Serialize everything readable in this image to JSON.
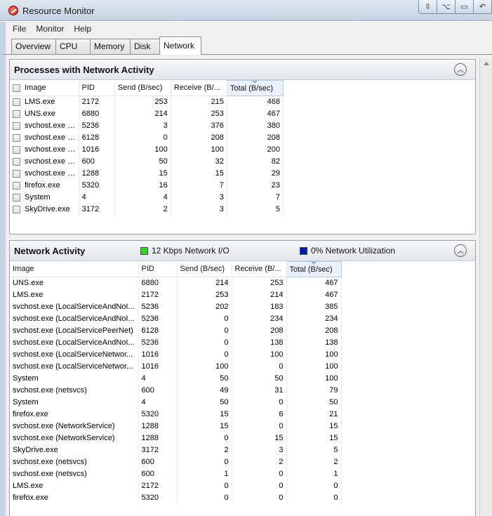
{
  "window": {
    "title": "Resource Monitor",
    "caption_buttons": [
      "⇳",
      "⌥",
      "▭",
      "↶",
      "✕"
    ]
  },
  "menu": [
    "File",
    "Monitor",
    "Help"
  ],
  "tabs": [
    "Overview",
    "CPU",
    "Memory",
    "Disk",
    "Network"
  ],
  "active_tab": "Network",
  "processes_panel": {
    "title": "Processes with Network Activity",
    "columns": [
      "Image",
      "PID",
      "Send (B/sec)",
      "Receive (B/...",
      "Total (B/sec)"
    ],
    "rows": [
      [
        "LMS.exe",
        "2172",
        "253",
        "215",
        "468"
      ],
      [
        "UNS.exe",
        "6880",
        "214",
        "253",
        "467"
      ],
      [
        "svchost.exe (...",
        "5236",
        "3",
        "376",
        "380"
      ],
      [
        "svchost.exe (...",
        "6128",
        "0",
        "208",
        "208"
      ],
      [
        "svchost.exe (...",
        "1016",
        "100",
        "100",
        "200"
      ],
      [
        "svchost.exe (...",
        "600",
        "50",
        "32",
        "82"
      ],
      [
        "svchost.exe (...",
        "1288",
        "15",
        "15",
        "29"
      ],
      [
        "firefox.exe",
        "5320",
        "16",
        "7",
        "23"
      ],
      [
        "System",
        "4",
        "4",
        "3",
        "7"
      ],
      [
        "SkyDrive.exe",
        "3172",
        "2",
        "3",
        "5"
      ]
    ]
  },
  "network_panel": {
    "title": "Network Activity",
    "legend_io": "12 Kbps Network I/O",
    "legend_util": "0% Network Utilization",
    "io_color": "#22dd22",
    "util_color": "#0a1aa8",
    "columns": [
      "Image",
      "PID",
      "Send (B/sec)",
      "Receive (B/...",
      "Total (B/sec)"
    ],
    "rows": [
      [
        "UNS.exe",
        "6880",
        "214",
        "253",
        "467"
      ],
      [
        "LMS.exe",
        "2172",
        "253",
        "214",
        "467"
      ],
      [
        "svchost.exe (LocalServiceAndNoI...",
        "5236",
        "202",
        "183",
        "385"
      ],
      [
        "svchost.exe (LocalServiceAndNoI...",
        "5236",
        "0",
        "234",
        "234"
      ],
      [
        "svchost.exe (LocalServicePeerNet)",
        "6128",
        "0",
        "208",
        "208"
      ],
      [
        "svchost.exe (LocalServiceAndNoI...",
        "5236",
        "0",
        "138",
        "138"
      ],
      [
        "svchost.exe (LocalServiceNetwor...",
        "1016",
        "0",
        "100",
        "100"
      ],
      [
        "svchost.exe (LocalServiceNetwor...",
        "1016",
        "100",
        "0",
        "100"
      ],
      [
        "System",
        "4",
        "50",
        "50",
        "100"
      ],
      [
        "svchost.exe (netsvcs)",
        "600",
        "49",
        "31",
        "79"
      ],
      [
        "System",
        "4",
        "50",
        "0",
        "50"
      ],
      [
        "firefox.exe",
        "5320",
        "15",
        "6",
        "21"
      ],
      [
        "svchost.exe (NetworkService)",
        "1288",
        "15",
        "0",
        "15"
      ],
      [
        "svchost.exe (NetworkService)",
        "1288",
        "0",
        "15",
        "15"
      ],
      [
        "SkyDrive.exe",
        "3172",
        "2",
        "3",
        "5"
      ],
      [
        "svchost.exe (netsvcs)",
        "600",
        "0",
        "2",
        "2"
      ],
      [
        "svchost.exe (netsvcs)",
        "600",
        "1",
        "0",
        "1"
      ],
      [
        "LMS.exe",
        "2172",
        "0",
        "0",
        "0"
      ],
      [
        "firefox.exe",
        "5320",
        "0",
        "0",
        "0"
      ]
    ]
  }
}
